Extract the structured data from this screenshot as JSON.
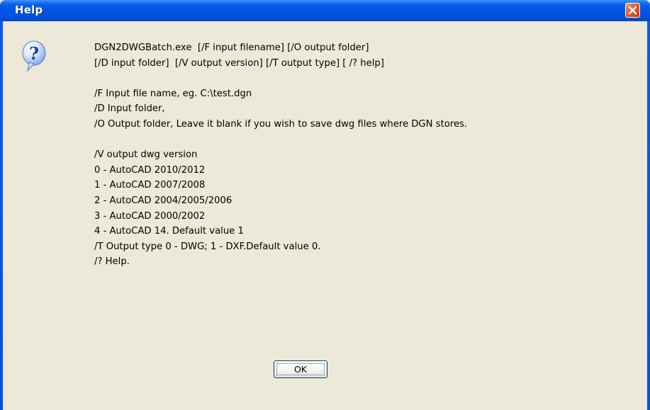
{
  "window": {
    "title": "Help",
    "close_icon": "close-icon"
  },
  "dialog": {
    "icon": "question-icon",
    "lines": [
      "DGN2DWGBatch.exe  [/F input filename] [/O output folder]",
      "[/D input folder]  [/V output version] [/T output type] [ /? help]",
      "",
      "/F Input file name, eg. C:\\test.dgn",
      "/D Input folder,",
      "/O Output folder, Leave it blank if you wish to save dwg files where DGN stores.",
      "",
      "/V output dwg version",
      "0 - AutoCAD 2010/2012",
      "1 - AutoCAD 2007/2008",
      "2 - AutoCAD 2004/2005/2006",
      "3 - AutoCAD 2000/2002",
      "4 - AutoCAD 14. Default value 1",
      "/T Output type 0 - DWG; 1 - DXF.Default value 0.",
      "/? Help."
    ],
    "ok_label": "OK"
  },
  "colors": {
    "titlebar": "#0054e3",
    "close_button": "#e5552f",
    "dialog_background": "#ece9d8"
  }
}
